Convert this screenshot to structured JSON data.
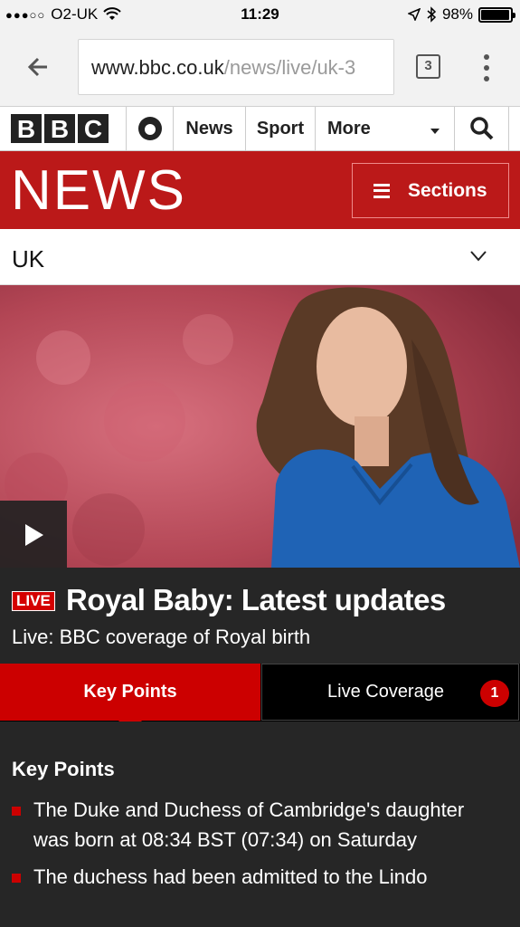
{
  "status_bar": {
    "carrier": "O2-UK",
    "time": "11:29",
    "battery": "98%",
    "battery_level": 0.98
  },
  "browser": {
    "url_host": "www.bbc.co.uk",
    "url_path": "/news/live/uk-3",
    "tab_count": "3"
  },
  "global_nav": {
    "logo": [
      "B",
      "B",
      "C"
    ],
    "items": [
      "News",
      "Sport",
      "More"
    ]
  },
  "banner": {
    "title": "NEWS",
    "sections_label": "Sections"
  },
  "section": {
    "current": "UK"
  },
  "story": {
    "live_label": "LIVE",
    "headline": "Royal Baby: Latest updates",
    "subhead": "Live: BBC coverage of Royal birth"
  },
  "tabs": {
    "key_points": "Key Points",
    "live_coverage": "Live Coverage",
    "live_count": "1"
  },
  "key_points": {
    "title": "Key Points",
    "items": [
      "The Duke and Duchess of Cambridge's daughter was born at 08:34 BST (07:34) on Saturday",
      "The duchess had been admitted to the Lindo"
    ]
  },
  "colors": {
    "bbc_red": "#bb1919",
    "tab_red": "#cc0000",
    "dark_bg": "#262626"
  }
}
